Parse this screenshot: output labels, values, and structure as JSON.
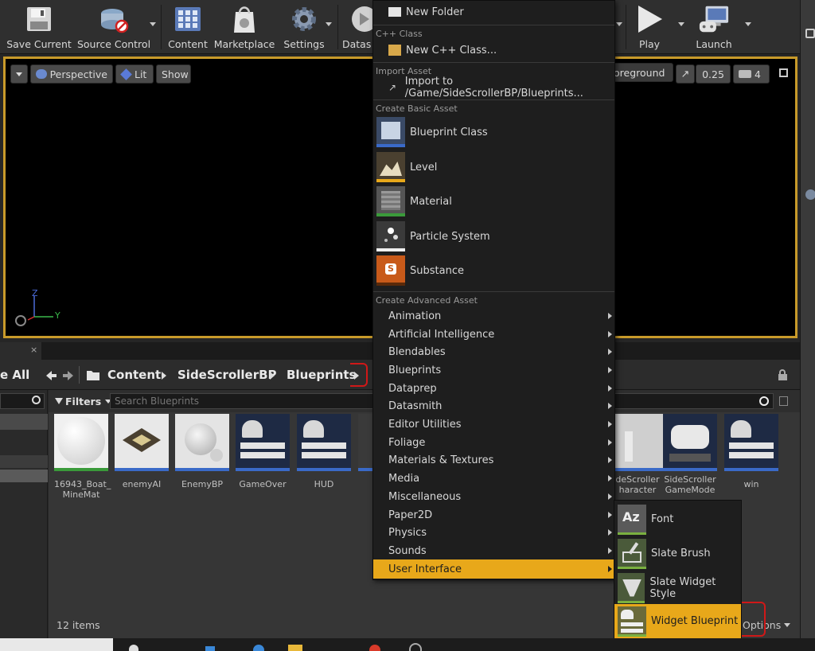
{
  "toolbar": {
    "buttons": [
      {
        "label": "Save Current",
        "icon": "floppy-disk-icon"
      },
      {
        "label": "Source Control",
        "icon": "source-control-icon"
      },
      {
        "label": "Content",
        "icon": "content-grid-icon"
      },
      {
        "label": "Marketplace",
        "icon": "marketplace-bag-icon"
      },
      {
        "label": "Settings",
        "icon": "gear-icon"
      },
      {
        "label": "Datas",
        "icon": "datasmith-icon"
      },
      {
        "label": "Play",
        "icon": "play-icon"
      },
      {
        "label": "Launch",
        "icon": "launch-monitor-icon"
      }
    ]
  },
  "viewport": {
    "perspective": "Perspective",
    "lit": "Lit",
    "show": "Show",
    "foreground": "oreground",
    "scale": "0.25",
    "camera_speed": "4",
    "axis_z": "Z",
    "axis_y": "Y"
  },
  "content_browser": {
    "save_all": "e All",
    "breadcrumbs": [
      "Content",
      "SideScrollerBP",
      "Blueprints"
    ],
    "filters": "Filters",
    "search_placeholder": "Search Blueprints",
    "item_count": "12 items",
    "view_options": "Options",
    "assets": [
      {
        "name": "16943_Boat_\nMineMat",
        "bar": "#3a9a3a"
      },
      {
        "name": "enemyAI",
        "bar": "#3a6ac8"
      },
      {
        "name": "EnemyBP",
        "bar": "#3a6ac8"
      },
      {
        "name": "GameOver",
        "bar": "#3a6ac8"
      },
      {
        "name": "HUD",
        "bar": "#3a6ac8"
      },
      {
        "name": "deScroller\nharacter",
        "bar": "#3a6ac8"
      },
      {
        "name": "SideScroller\nGameMode",
        "bar": "#3a6ac8"
      },
      {
        "name": "win",
        "bar": "#3a6ac8"
      }
    ]
  },
  "menu": {
    "new_folder": "New Folder",
    "cpp_header": "C++ Class",
    "new_cpp": "New C++ Class...",
    "import_header": "Import Asset",
    "import_to": "Import to /Game/SideScrollerBP/Blueprints...",
    "basic_header": "Create Basic Asset",
    "basic": [
      "Blueprint Class",
      "Level",
      "Material",
      "Particle System",
      "Substance"
    ],
    "advanced_header": "Create Advanced Asset",
    "advanced": [
      "Animation",
      "Artificial Intelligence",
      "Blendables",
      "Blueprints",
      "Dataprep",
      "Datasmith",
      "Editor Utilities",
      "Foliage",
      "Materials & Textures",
      "Media",
      "Miscellaneous",
      "Paper2D",
      "Physics",
      "Sounds",
      "User Interface"
    ],
    "selected": "User Interface"
  },
  "submenu": {
    "items": [
      "Font",
      "Slate Brush",
      "Slate Widget Style",
      "Widget Blueprint"
    ],
    "selected": "Widget Blueprint"
  },
  "colors": {
    "accent": "#e8a81a",
    "viewport_border": "#c89a2a",
    "annotation": "#d01818"
  }
}
